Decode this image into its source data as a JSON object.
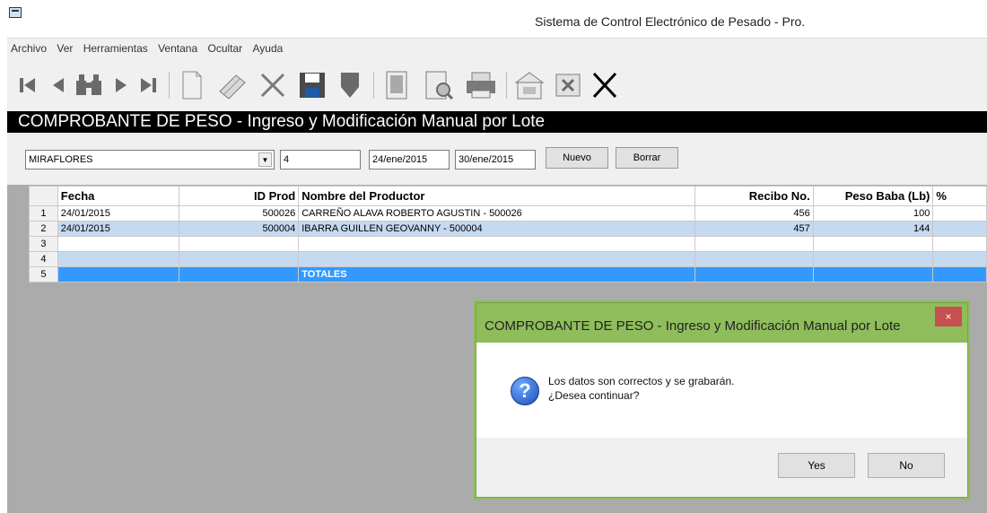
{
  "window": {
    "title": "Sistema de Control Electrónico de Pesado - Pro."
  },
  "menu": [
    "Archivo",
    "Ver",
    "Herramientas",
    "Ventana",
    "Ocultar",
    "Ayuda"
  ],
  "toolbar": {
    "icons": [
      "first-record-icon",
      "previous-record-icon",
      "binoculars-search-icon",
      "next-record-icon",
      "last-record-icon",
      "new-document-icon",
      "edit-eraser-icon",
      "delete-icon",
      "save-floppy-icon",
      "undo-icon",
      "report-icon",
      "print-preview-icon",
      "printer-icon",
      "export-icon",
      "excel-icon",
      "close-icon"
    ]
  },
  "form": {
    "caption": "COMPROBANTE DE PESO - Ingreso y Modificación Manual por Lote"
  },
  "filters": {
    "location": "MIRAFLORES",
    "lot": "4",
    "date_from": "24/ene/2015",
    "date_to": "30/ene/2015",
    "new_button": "Nuevo",
    "delete_button": "Borrar"
  },
  "grid": {
    "columns": [
      "Fecha",
      "ID Prod",
      "Nombre del Productor",
      "Recibo No.",
      "Peso Baba (Lb)",
      "% "
    ],
    "rows": [
      {
        "n": "1",
        "fecha": "24/01/2015",
        "id": "500026",
        "nombre": "CARREÑO ALAVA ROBERTO AGUSTIN   - 500026",
        "recibo": "456",
        "peso": "100",
        "pct": ""
      },
      {
        "n": "2",
        "fecha": "24/01/2015",
        "id": "500004",
        "nombre": "IBARRA GUILLEN GEOVANNY    - 500004",
        "recibo": "457",
        "peso": "144",
        "pct": ""
      },
      {
        "n": "3",
        "fecha": "",
        "id": "",
        "nombre": "",
        "recibo": "",
        "peso": "",
        "pct": ""
      },
      {
        "n": "4",
        "fecha": "",
        "id": "",
        "nombre": "",
        "recibo": "",
        "peso": "",
        "pct": ""
      },
      {
        "n": "5",
        "fecha": "",
        "id": "",
        "nombre": "TOTALES",
        "recibo": "",
        "peso": "",
        "pct": ""
      }
    ]
  },
  "dialog": {
    "title": "COMPROBANTE DE PESO - Ingreso y Modificación Manual por Lote",
    "close": "×",
    "line1": "Los datos son correctos y se grabarán.",
    "line2": "¿Desea continuar?",
    "yes": "Yes",
    "no": "No"
  }
}
